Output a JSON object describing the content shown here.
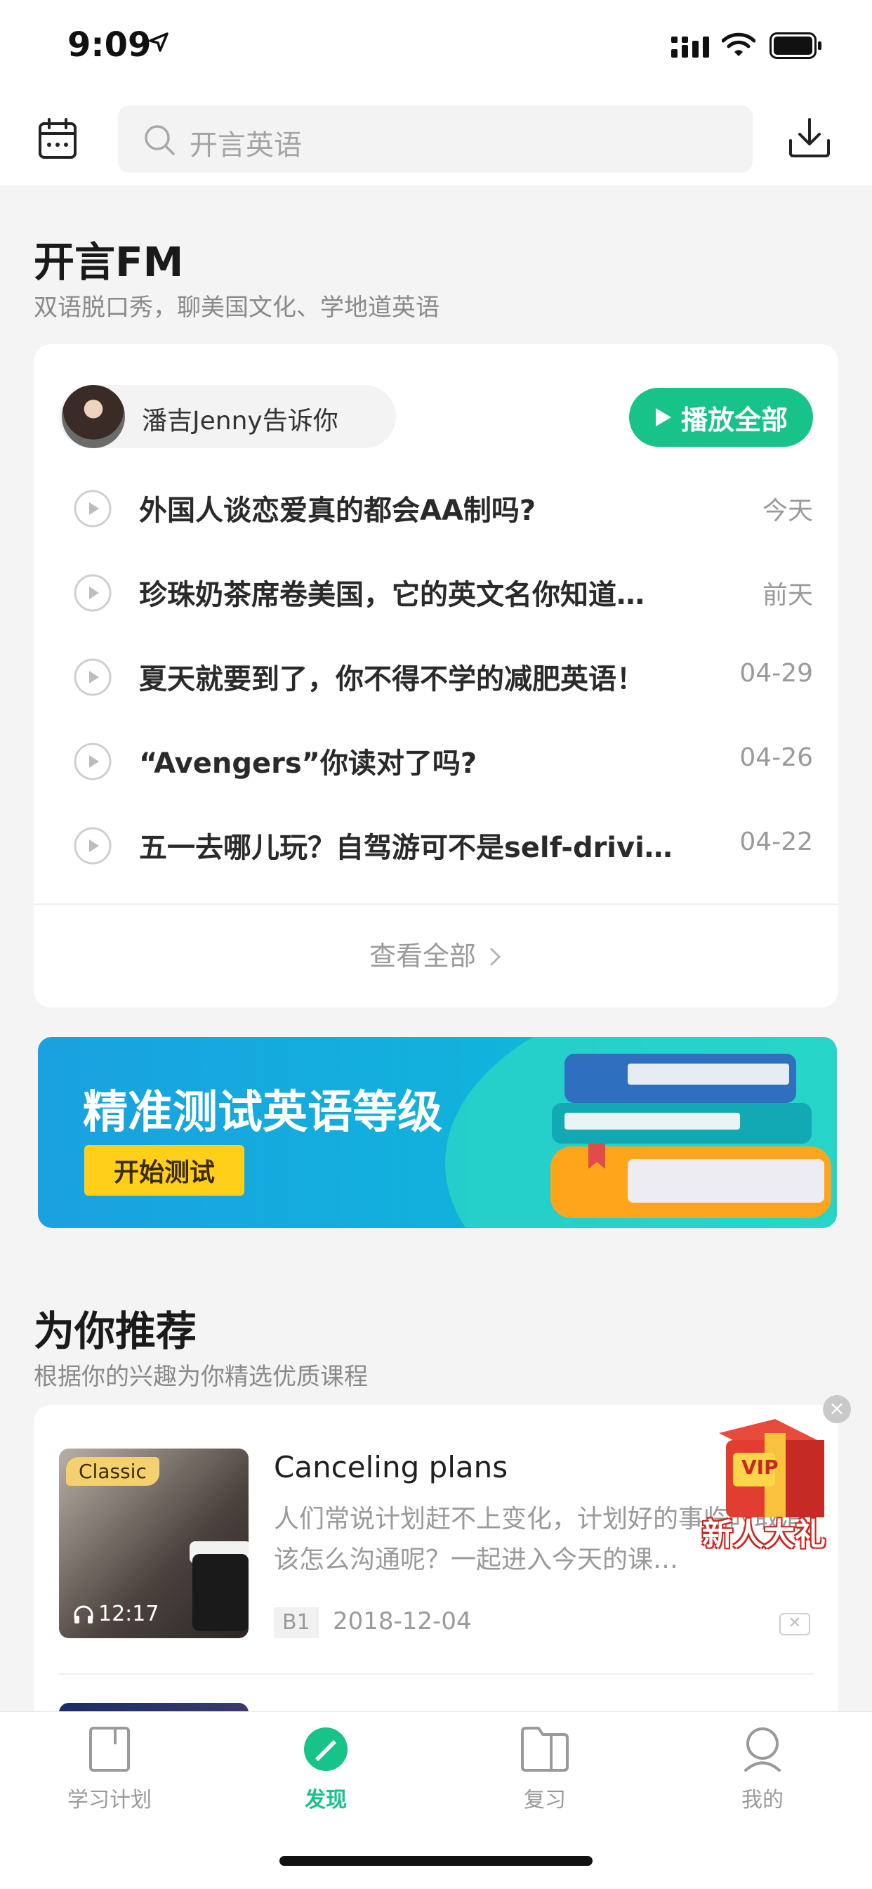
{
  "status_bar": {
    "time": "9:09"
  },
  "header": {
    "search_placeholder": "开言英语"
  },
  "fm_section": {
    "title": "开言FM",
    "subtitle": "双语脱口秀，聊美国文化、学地道英语",
    "author": "潘吉Jenny告诉你",
    "play_all_label": "播放全部",
    "episodes": [
      {
        "title": "外国人谈恋爱真的都会AA制吗?",
        "date": "今天"
      },
      {
        "title": "珍珠奶茶席卷美国，它的英文名你知道…",
        "date": "前天"
      },
      {
        "title": "夏天就要到了，你不得不学的减肥英语！",
        "date": "04-29"
      },
      {
        "title": "“Avengers”你读对了吗?",
        "date": "04-26"
      },
      {
        "title": "五一去哪儿玩？自驾游可不是self-drivi…",
        "date": "04-22"
      }
    ],
    "view_all_label": "查看全部"
  },
  "banner": {
    "title": "精准测试英语等级",
    "button_label": "开始测试"
  },
  "recommend_section": {
    "title": "为你推荐",
    "subtitle": "根据你的兴趣为你精选优质课程",
    "items": [
      {
        "badge": "Classic",
        "duration": "12:17",
        "title": "Canceling plans",
        "description": "人们常说计划赶不上变化，计划好的事临时取消该怎么沟通呢？一起进入今天的课…",
        "level": "B1",
        "date": "2018-12-04"
      }
    ]
  },
  "promo": {
    "badge": "VIP",
    "label": "新人大礼"
  },
  "tab_bar": {
    "tabs": [
      {
        "label": "学习计划",
        "icon": "study-plan-icon",
        "active": false
      },
      {
        "label": "发现",
        "icon": "discover-icon",
        "active": true
      },
      {
        "label": "复习",
        "icon": "review-icon",
        "active": false
      },
      {
        "label": "我的",
        "icon": "profile-icon",
        "active": false
      }
    ]
  },
  "colors": {
    "accent": "#17c389",
    "banner_button": "#ffcf1a"
  }
}
